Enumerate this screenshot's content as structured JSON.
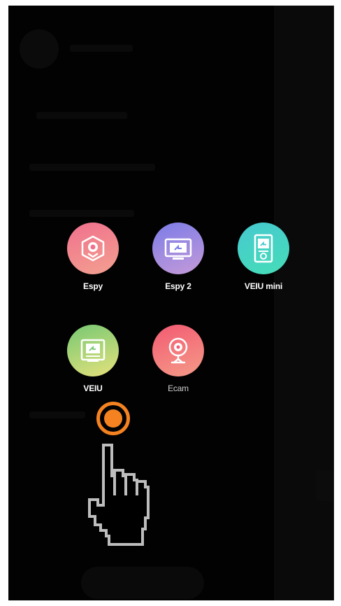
{
  "devices": [
    {
      "label": "Espy",
      "icon": "doorbell-camera-icon",
      "color": "#f0708d"
    },
    {
      "label": "Espy 2",
      "icon": "monitor-screen-icon",
      "color": "#7b7ce8"
    },
    {
      "label": "VEIU mini",
      "icon": "video-intercom-icon",
      "color": "#45c9cf"
    },
    {
      "label": "VEIU",
      "icon": "indoor-monitor-icon",
      "color": "#76c873"
    },
    {
      "label": "Ecam",
      "icon": "webcam-icon",
      "color": "#f35a72"
    }
  ],
  "tap_indicator_color": "#f58220",
  "pointer": "hand-pointer-icon"
}
